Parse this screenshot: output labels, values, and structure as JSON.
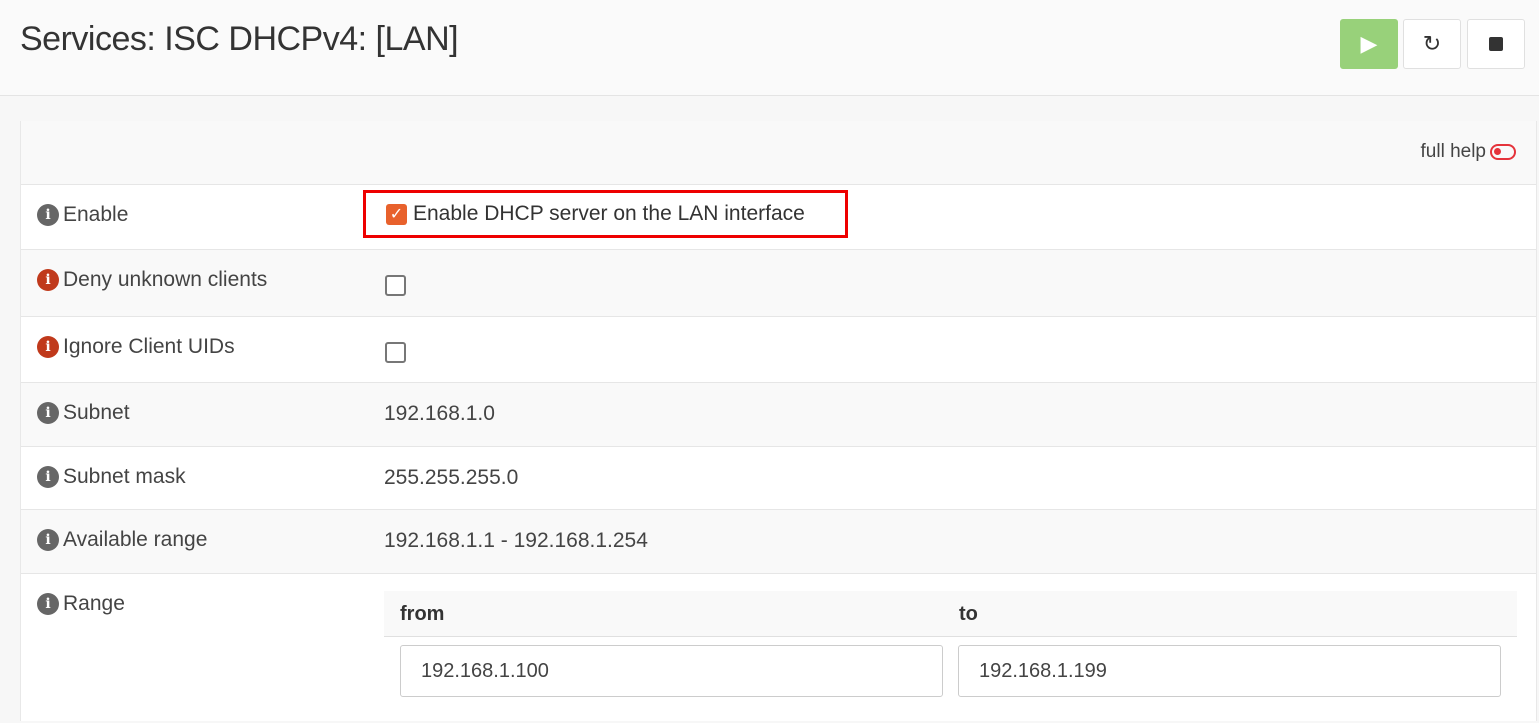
{
  "header": {
    "title": "Services: ISC DHCPv4: [LAN]",
    "buttons": {
      "start": "play-icon",
      "restart": "restart-icon",
      "stop": "stop-icon"
    }
  },
  "panel": {
    "full_help": "full help",
    "rows": [
      {
        "label": "Enable",
        "checkbox_label": "Enable DHCP server on the LAN interface",
        "checked": true
      },
      {
        "label": "Deny unknown clients",
        "checked": false
      },
      {
        "label": "Ignore Client UIDs",
        "checked": false
      },
      {
        "label": "Subnet",
        "value": "192.168.1.0"
      },
      {
        "label": "Subnet mask",
        "value": "255.255.255.0"
      },
      {
        "label": "Available range",
        "value": "192.168.1.1 - 192.168.1.254"
      },
      {
        "label": "Range",
        "from_header": "from",
        "to_header": "to",
        "from": "192.168.1.100",
        "to": "192.168.1.199"
      }
    ]
  },
  "colors": {
    "start": "#98d17a",
    "checkbox": "#e8612c",
    "highlight": "#ee0000",
    "warn_info": "#c0391b"
  }
}
